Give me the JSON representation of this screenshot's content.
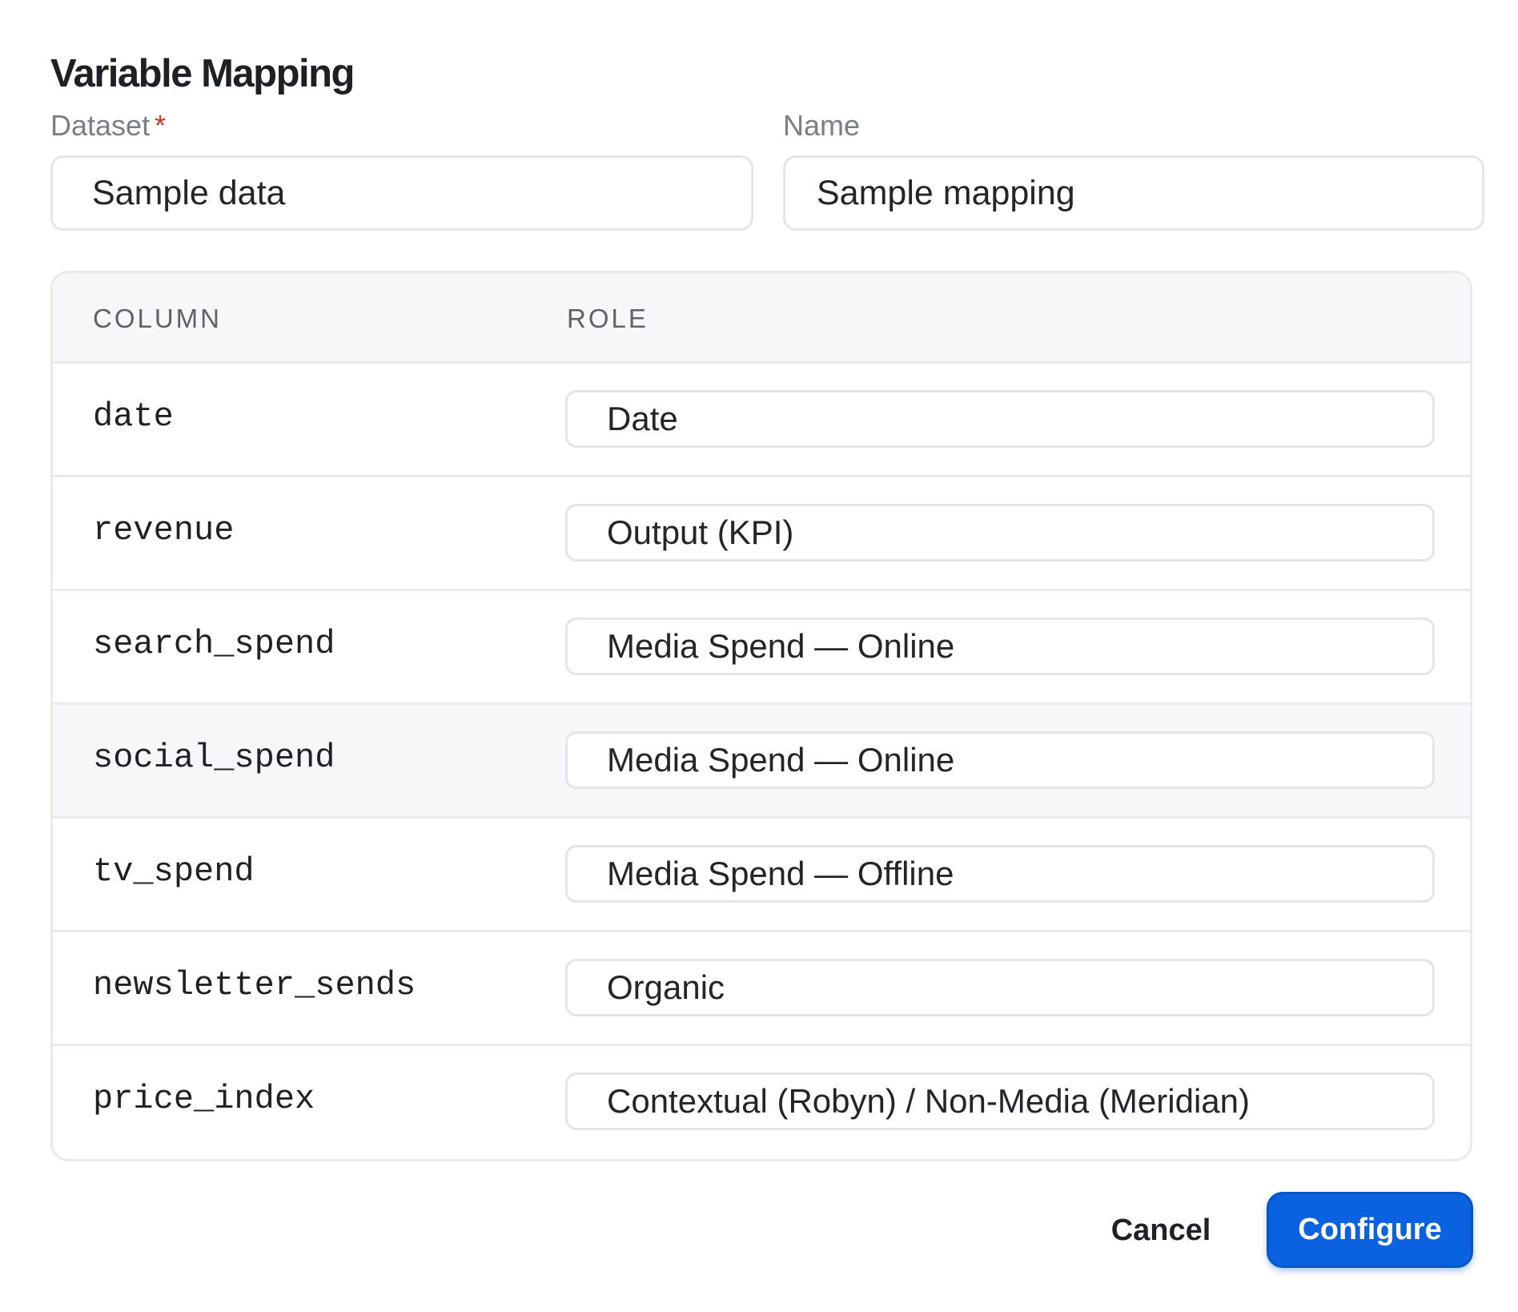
{
  "dialog": {
    "title": "Variable Mapping",
    "dataset": {
      "label": "Dataset",
      "required_mark": "*",
      "value": "Sample data"
    },
    "name": {
      "label": "Name",
      "value": "Sample mapping"
    },
    "table": {
      "headers": {
        "column": "COLUMN",
        "role": "ROLE"
      },
      "rows": [
        {
          "column": "date",
          "role": "Date"
        },
        {
          "column": "revenue",
          "role": "Output (KPI)"
        },
        {
          "column": "search_spend",
          "role": "Media Spend — Online"
        },
        {
          "column": "social_spend",
          "role": "Media Spend — Online"
        },
        {
          "column": "tv_spend",
          "role": "Media Spend — Offline"
        },
        {
          "column": "newsletter_sends",
          "role": "Organic"
        },
        {
          "column": "price_index",
          "role": "Contextual (Robyn) / Non-Media (Meridian)"
        }
      ]
    },
    "actions": {
      "cancel": "Cancel",
      "configure": "Configure"
    },
    "colors": {
      "primary": "#0b62e0",
      "required": "#d93025"
    }
  }
}
